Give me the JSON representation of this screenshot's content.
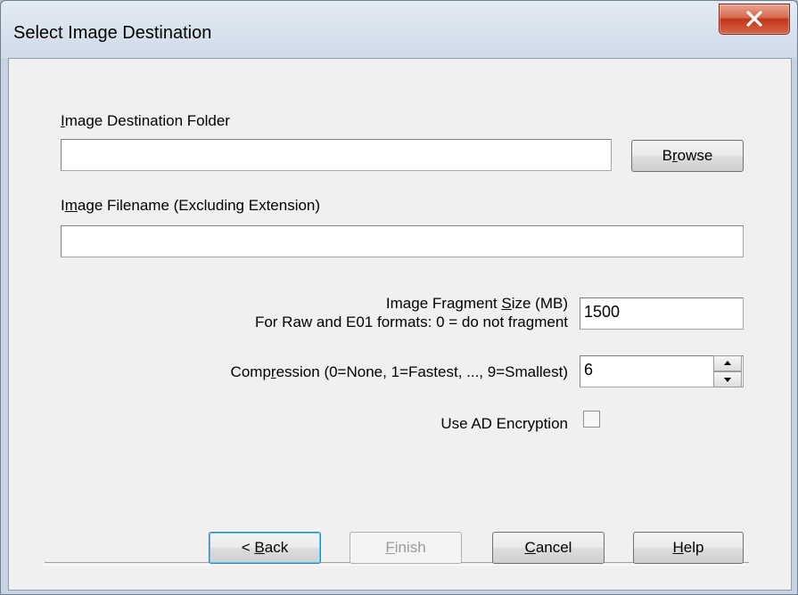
{
  "window": {
    "title": "Select Image Destination",
    "close_glyph": "X"
  },
  "fields": {
    "destination_folder_label": "Image Destination Folder",
    "destination_folder_value": "",
    "browse_label": "Browse",
    "filename_label": "Image Filename (Excluding Extension)",
    "filename_value": "",
    "fragment_label_line1": "Image Fragment Size (MB)",
    "fragment_label_line2": "For Raw and E01 formats: 0 = do not fragment",
    "fragment_value": "1500",
    "compression_label": "Compression (0=None, 1=Fastest, ..., 9=Smallest)",
    "compression_value": "6",
    "encryption_label": "Use AD Encryption",
    "encryption_checked": false
  },
  "buttons": {
    "back": "< Back",
    "finish": "Finish",
    "cancel": "Cancel",
    "help": "Help"
  },
  "icons": {
    "close": "close-icon",
    "spin_up": "spin-up-icon",
    "spin_down": "spin-down-icon"
  },
  "colors": {
    "close_button": "#c7452b",
    "dialog_face": "#f0f0f0",
    "frame": "#c7d4e3"
  }
}
